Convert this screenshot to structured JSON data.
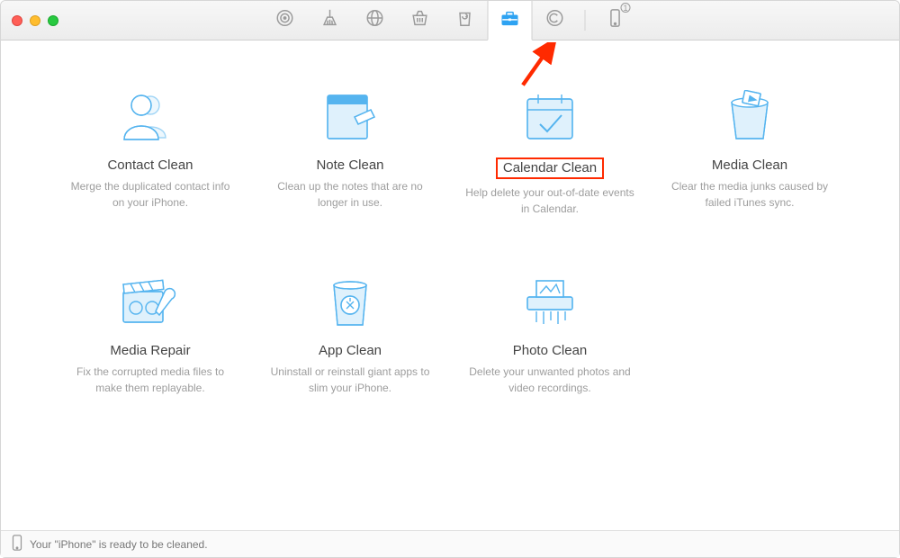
{
  "toolbar": {
    "tabs": [
      "target",
      "sweep",
      "globe",
      "basket",
      "recycle",
      "toolbox",
      "copyright"
    ],
    "active_index": 5,
    "device_badge": "1"
  },
  "annotations": {
    "arrow_points_to": "toolbox-tab",
    "highlighted_card": "calendar-clean"
  },
  "cards": [
    {
      "id": "contact-clean",
      "title": "Contact Clean",
      "desc": "Merge the duplicated contact info on your iPhone."
    },
    {
      "id": "note-clean",
      "title": "Note Clean",
      "desc": "Clean up the notes that are no longer in use."
    },
    {
      "id": "calendar-clean",
      "title": "Calendar Clean",
      "desc": "Help delete your out-of-date events in Calendar."
    },
    {
      "id": "media-clean",
      "title": "Media Clean",
      "desc": "Clear the media junks caused by failed iTunes sync."
    },
    {
      "id": "media-repair",
      "title": "Media Repair",
      "desc": "Fix the corrupted media files to make them replayable."
    },
    {
      "id": "app-clean",
      "title": "App Clean",
      "desc": "Uninstall or reinstall giant apps to slim your iPhone."
    },
    {
      "id": "photo-clean",
      "title": "Photo Clean",
      "desc": "Delete your unwanted photos and video recordings."
    }
  ],
  "status": {
    "text": "Your \"iPhone\" is ready to be cleaned."
  }
}
